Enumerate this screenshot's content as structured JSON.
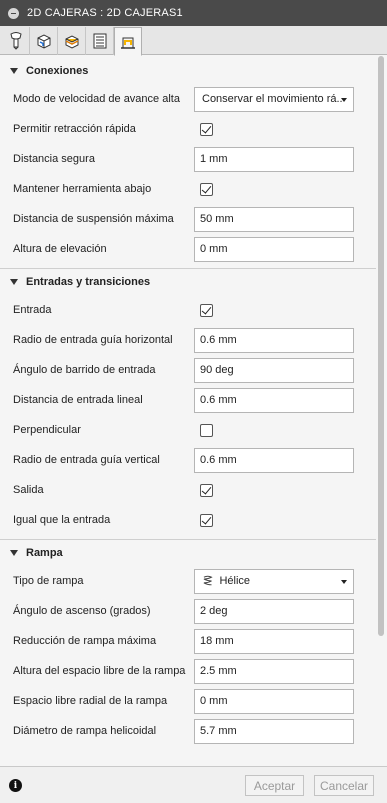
{
  "window": {
    "title": "2D CAJERAS : 2D CAJERAS1"
  },
  "tabs": [
    {
      "icon": "tool-icon"
    },
    {
      "icon": "geometry-icon"
    },
    {
      "icon": "heights-icon"
    },
    {
      "icon": "passes-icon"
    },
    {
      "icon": "linking-icon",
      "active": true
    }
  ],
  "sections": {
    "conexiones": {
      "title": "Conexiones",
      "feed_mode_label": "Modo de velocidad de avance alta",
      "feed_mode_value": "Conservar el movimiento rá...",
      "rapid_retract_label": "Permitir retracción rápida",
      "rapid_retract_checked": true,
      "safe_distance_label": "Distancia segura",
      "safe_distance_value": "1 mm",
      "keep_tool_down_label": "Mantener herramienta abajo",
      "keep_tool_down_checked": true,
      "max_stay_down_label": "Distancia de suspensión máxima",
      "max_stay_down_value": "50 mm",
      "lift_height_label": "Altura de elevación",
      "lift_height_value": "0 mm"
    },
    "entradas": {
      "title": "Entradas y transiciones",
      "lead_in_label": "Entrada",
      "lead_in_checked": true,
      "h_radius_label": "Radio de entrada guía horizontal",
      "h_radius_value": "0.6 mm",
      "sweep_label": "Ángulo de barrido de entrada",
      "sweep_value": "90 deg",
      "linear_label": "Distancia de entrada lineal",
      "linear_value": "0.6 mm",
      "perpendicular_label": "Perpendicular",
      "perpendicular_checked": false,
      "v_radius_label": "Radio de entrada guía vertical",
      "v_radius_value": "0.6 mm",
      "lead_out_label": "Salida",
      "lead_out_checked": true,
      "same_label": "Igual que la entrada",
      "same_checked": true
    },
    "rampa": {
      "title": "Rampa",
      "type_label": "Tipo de rampa",
      "type_value": "Hélice",
      "angle_label": "Ángulo de ascenso (grados)",
      "angle_value": "2 deg",
      "stepdown_label": "Reducción de rampa máxima",
      "stepdown_value": "18 mm",
      "clearance_label": "Altura del espacio libre de la rampa",
      "clearance_value": "2.5 mm",
      "radial_label": "Espacio libre radial de la rampa",
      "radial_value": "0 mm",
      "diameter_label": "Diámetro de rampa helicoidal",
      "diameter_value": "5.7 mm"
    }
  },
  "footer": {
    "ok_label": "Aceptar",
    "cancel_label": "Cancelar",
    "info_glyph": "i"
  }
}
